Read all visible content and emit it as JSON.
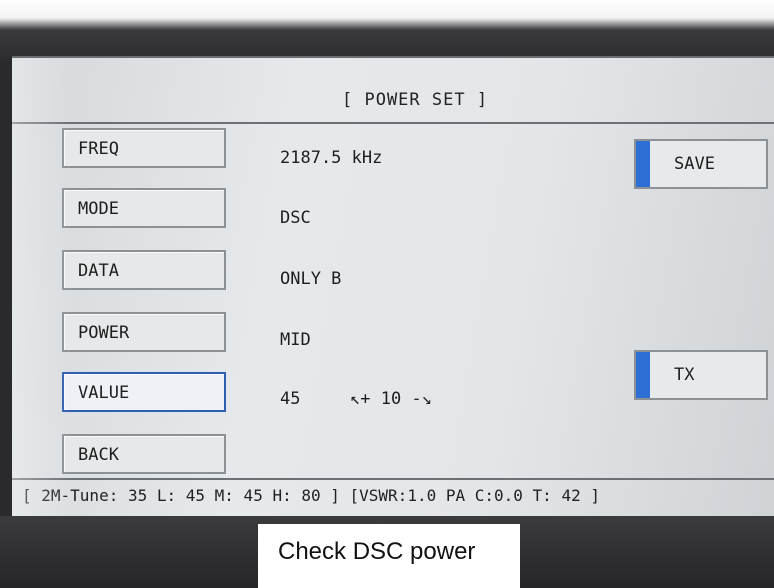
{
  "screen": {
    "title": "[ POWER SET ]"
  },
  "menu": {
    "freq_label": "FREQ",
    "mode_label": "MODE",
    "data_label": "DATA",
    "power_label": "POWER",
    "value_label": "VALUE",
    "back_label": "BACK"
  },
  "values": {
    "freq": "2187.5 kHz",
    "mode": "DSC",
    "data": "ONLY B",
    "power": "MID",
    "value": "45",
    "step_hint": "↖+ 10 -↘"
  },
  "actions": {
    "save_label": "SAVE",
    "tx_label": "TX"
  },
  "status_bar": {
    "text": "[ 2M-Tune: 35 L: 45 M: 45 H: 80 ] [VSWR:1.0 PA C:0.0 T: 42 ]"
  },
  "caption": {
    "text": "Check DSC power"
  },
  "colors": {
    "accent": "#2e6fd6",
    "selected_border": "#2f5fb0",
    "screen_bg": "#e3e6e8"
  }
}
